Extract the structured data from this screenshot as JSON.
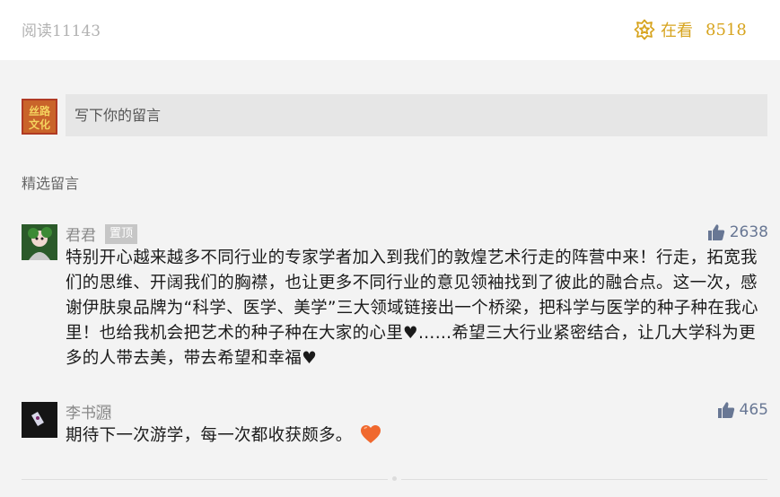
{
  "header": {
    "read_label": "阅读11143",
    "wow_label": "在看",
    "wow_count": "8518"
  },
  "comment_box": {
    "placeholder": "写下你的留言",
    "avatar_text": "丝路\n文化"
  },
  "section_title": "精选留言",
  "comments": [
    {
      "name": "君君",
      "badge": "置顶",
      "likes": "2638",
      "text": "特别开心越来越多不同行业的专家学者加入到我们的敦煌艺术行走的阵营中来！行走，拓宽我们的思维、开阔我们的胸襟，也让更多不同行业的意见领袖找到了彼此的融合点。这一次，感谢伊肤泉品牌为“科学、医学、美学”三大领域链接出一个桥梁，把科学与医学的种子种在我心里！也给我机会把艺术的种子种在大家的心里♥……希望三大行业紧密结合，让几大学科为更多的人带去美，带去希望和幸福♥"
    },
    {
      "name": "李书源⃞",
      "likes": "465",
      "text": "期待下一次游学，每一次都收获颇多。",
      "emoji": "heart-emoji"
    }
  ],
  "colors": {
    "accent_gold": "#d7a41f",
    "like_blue": "#687794",
    "background": "#f3f3f3"
  }
}
